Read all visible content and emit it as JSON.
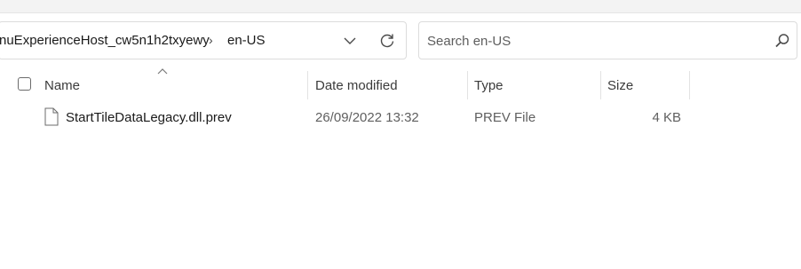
{
  "address": {
    "crumbs": [
      "nuExperienceHost_cw5n1h2txyewy",
      "en-US"
    ],
    "separator": "›"
  },
  "search": {
    "placeholder": "Search en-US",
    "value": ""
  },
  "columns": {
    "name": "Name",
    "date_modified": "Date modified",
    "type": "Type",
    "size": "Size"
  },
  "files": [
    {
      "name": "StartTileDataLegacy.dll.prev",
      "date_modified": "26/09/2022 13:32",
      "type": "PREV File",
      "size": "4 KB"
    }
  ],
  "icons": {
    "dropdown": "chevron-down-icon",
    "refresh": "refresh-icon",
    "search": "search-icon",
    "file": "file-icon",
    "sort": "sort-ascending-icon"
  }
}
